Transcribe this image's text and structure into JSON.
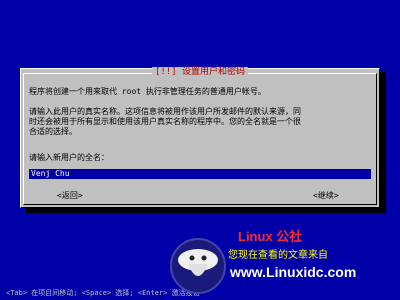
{
  "dialog": {
    "title": "[!!] 设置用户和密码",
    "paragraph1": "程序将创建一个用来取代 root 执行非管理任务的普通用户帐号。",
    "paragraph2": "请输入此用户的真实名称。这项信息将被用作该用户所发邮件的默认来源，同\n时还会被用于所有显示和使用该用户真实名称的程序中。您的全名就是一个很\n合适的选择。",
    "prompt": "请输入新用户的全名：",
    "fullname_value": "Venj Chu",
    "back_label": "<返回>",
    "continue_label": "<继续>"
  },
  "statusbar": {
    "text": "<Tab> 在项目间移动; <Space> 选择; <Enter> 激活按钮"
  },
  "watermark": {
    "brand": "Linux 公社",
    "tagline": "您现在查看的文章来自",
    "url": "www.Linuxidc.com"
  },
  "colors": {
    "background": "#0000a8",
    "dialog": "#c0c0c0",
    "title": "#b00000",
    "watermark_brand": "#ff2a2a",
    "watermark_tagline": "#ffff00"
  }
}
